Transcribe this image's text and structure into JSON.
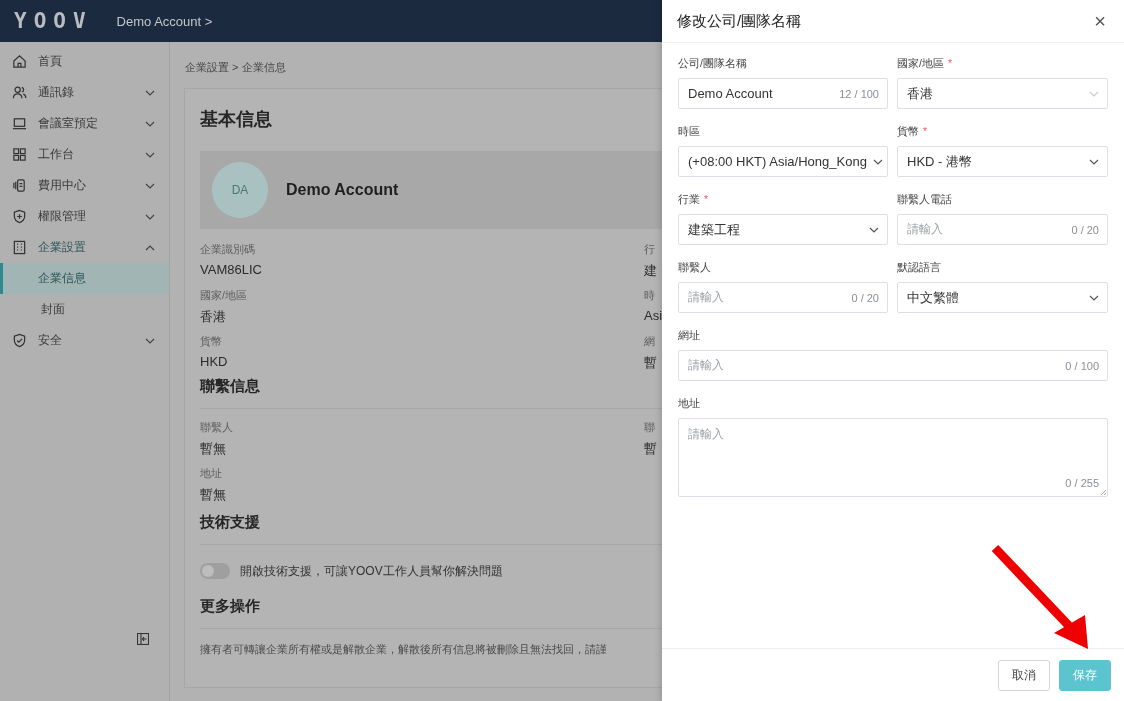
{
  "header": {
    "logo": "YOOV",
    "account": "Demo Account >"
  },
  "sidebar": {
    "items": [
      {
        "label": "首頁"
      },
      {
        "label": "通訊錄",
        "expanded": false
      },
      {
        "label": "會議室預定",
        "expanded": false
      },
      {
        "label": "工作台",
        "expanded": false
      },
      {
        "label": "費用中心",
        "expanded": false
      },
      {
        "label": "權限管理",
        "expanded": false
      },
      {
        "label": "企業設置",
        "expanded": true,
        "children": [
          {
            "label": "企業信息",
            "selected": true
          },
          {
            "label": "封面",
            "selected": false
          }
        ]
      },
      {
        "label": "安全",
        "expanded": false
      }
    ]
  },
  "breadcrumb": "企業設置 > 企業信息",
  "basic_info": {
    "title": "基本信息",
    "avatar": "DA",
    "name": "Demo Account",
    "fields": [
      {
        "label": "企業識別碼",
        "value": "VAM86LIC"
      },
      {
        "label": "國家/地區",
        "value": "香港"
      },
      {
        "label": "貨幣",
        "value": "HKD"
      }
    ],
    "fields_right": [
      {
        "label": "行",
        "value": "建"
      },
      {
        "label": "時",
        "value": "Asi"
      },
      {
        "label": "網",
        "value": "暫"
      }
    ]
  },
  "contact_info": {
    "title": "聯繫信息",
    "fields": [
      {
        "label": "聯繫人",
        "value": "暫無"
      },
      {
        "label": "地址",
        "value": "暫無"
      }
    ],
    "fields_right": [
      {
        "label": "聯",
        "value": "暫"
      }
    ]
  },
  "tech_support": {
    "title": "技術支援",
    "toggle": {
      "on": false,
      "label": "開啟技術支援，可讓YOOV工作人員幫你解決問題"
    }
  },
  "more_actions": {
    "title": "更多操作",
    "description": "擁有者可轉讓企業所有權或是解散企業，解散後所有信息將被刪除且無法找回，請謹"
  },
  "drawer": {
    "title": "修改公司/團隊名稱",
    "close": "×",
    "fields": [
      {
        "kind": "text",
        "label": "公司/團隊名稱",
        "full_width": false,
        "value": "Demo Account",
        "counter": "12 / 100"
      },
      {
        "kind": "select",
        "label": "國家/地區",
        "required_mark": "*",
        "full_width": false,
        "value": "香港",
        "disabled": true
      },
      {
        "kind": "select",
        "label": "時區",
        "full_width": false,
        "value": "(+08:00 HKT) Asia/Hong_Kong",
        "disabled": false
      },
      {
        "kind": "select",
        "label": "貨幣",
        "required_mark": "*",
        "full_width": false,
        "value": "HKD - 港幣",
        "disabled": false
      },
      {
        "kind": "select",
        "label": "行業",
        "required_mark": "*",
        "full_width": false,
        "value": "建築工程",
        "disabled": false
      },
      {
        "kind": "text",
        "label": "聯繫人電話",
        "full_width": false,
        "placeholder": "請輸入",
        "counter": "0 / 20"
      },
      {
        "kind": "text",
        "label": "聯繫人",
        "full_width": false,
        "placeholder": "請輸入",
        "counter": "0 / 20"
      },
      {
        "kind": "select",
        "label": "默認語言",
        "full_width": false,
        "value": "中文繁體",
        "disabled": false
      },
      {
        "kind": "text",
        "label": "網址",
        "full_width": true,
        "placeholder": "請輸入",
        "counter": "0 / 100"
      },
      {
        "kind": "textarea",
        "label": "地址",
        "full_width": true,
        "placeholder": "請輸入",
        "counter": "0 / 255"
      }
    ],
    "buttons": [
      {
        "kind": "default",
        "label": "取消"
      },
      {
        "kind": "primary",
        "label": "保存"
      }
    ]
  }
}
